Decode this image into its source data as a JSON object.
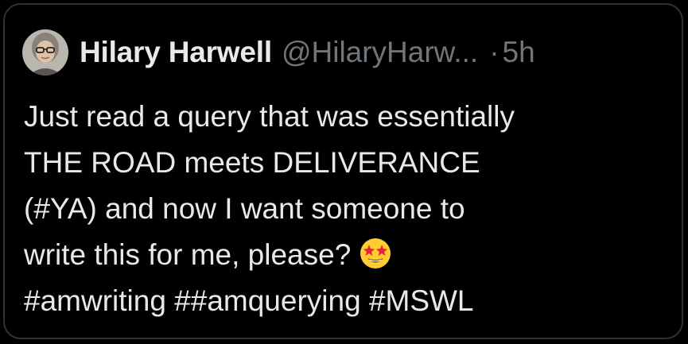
{
  "tweet": {
    "author_name": "Hilary Harwell",
    "handle": "@HilaryHarw...",
    "separator": "·",
    "time": "5h",
    "lines": [
      "Just read a query that was essentially",
      "THE ROAD meets DELIVERANCE",
      "(#YA) and now I want someone to",
      "write this for me, please?",
      "#amwriting ##amquerying #MSWL"
    ],
    "emoji": "star-struck-emoji"
  },
  "colors": {
    "background": "#000000",
    "border": "#2f3336",
    "text_primary": "#e7e9ea",
    "text_secondary": "#71767b"
  }
}
